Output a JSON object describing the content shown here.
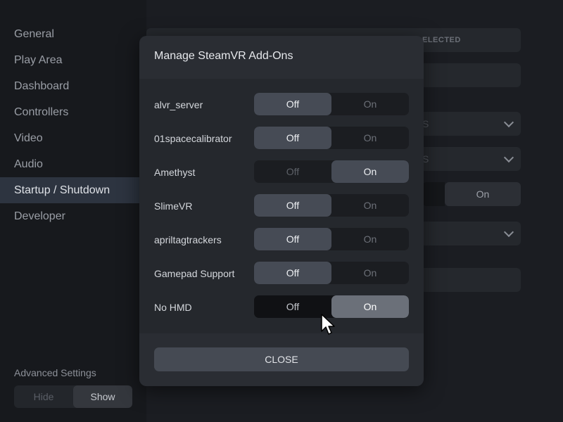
{
  "sidebar": {
    "items": [
      {
        "label": "General"
      },
      {
        "label": "Play Area"
      },
      {
        "label": "Dashboard"
      },
      {
        "label": "Controllers"
      },
      {
        "label": "Video"
      },
      {
        "label": "Audio"
      },
      {
        "label": "Startup / Shutdown"
      },
      {
        "label": "Developer"
      }
    ],
    "active_index": 6,
    "advanced": {
      "label": "Advanced Settings",
      "hide_label": "Hide",
      "show_label": "Show",
      "selected": "Show"
    }
  },
  "background": {
    "badge_text": "ELECTED",
    "row1_ghost": "S",
    "row2_ghost": "S",
    "on_label": "On"
  },
  "modal": {
    "title": "Manage SteamVR Add-Ons",
    "addons": [
      {
        "name": "alvr_server",
        "off_label": "Off",
        "on_label": "On",
        "state": "off"
      },
      {
        "name": "01spacecalibrator",
        "off_label": "Off",
        "on_label": "On",
        "state": "off"
      },
      {
        "name": "Amethyst",
        "off_label": "Off",
        "on_label": "On",
        "state": "on"
      },
      {
        "name": "SlimeVR",
        "off_label": "Off",
        "on_label": "On",
        "state": "off"
      },
      {
        "name": "apriltagtrackers",
        "off_label": "Off",
        "on_label": "On",
        "state": "off"
      },
      {
        "name": "Gamepad Support",
        "off_label": "Off",
        "on_label": "On",
        "state": "off"
      },
      {
        "name": "No HMD",
        "off_label": "Off",
        "on_label": "On",
        "state": "on"
      }
    ],
    "close_label": "CLOSE"
  },
  "colors": {
    "accent_active_nav": "#2d3440",
    "toggle_selected": "#464b55",
    "modal_bg": "#2a2d33"
  }
}
